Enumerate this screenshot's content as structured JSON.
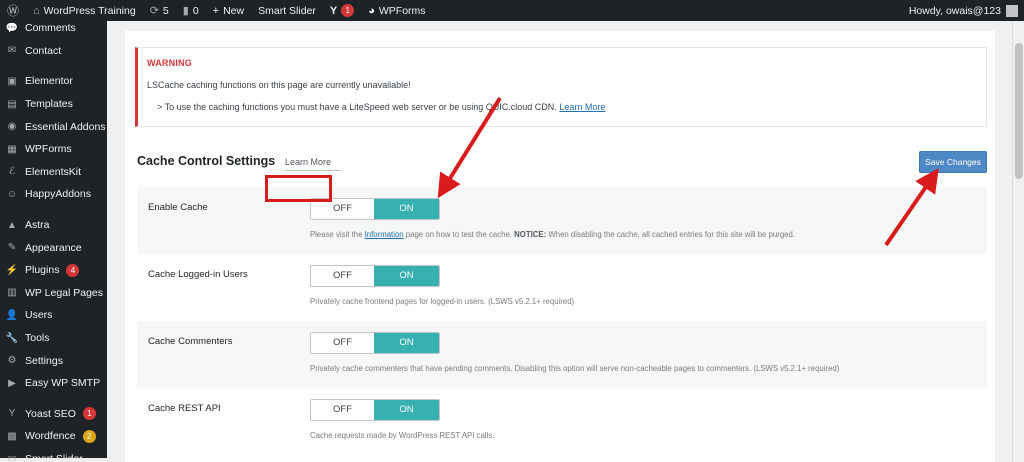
{
  "adminbar": {
    "site_name": "WordPress Training",
    "updates_count": "5",
    "comments_count": "0",
    "new_label": "New",
    "smart_slider_label": "Smart Slider",
    "yoast_badge": "1",
    "wpforms_label": "WPForms",
    "howdy_text": "Howdy, owais@123"
  },
  "sidebar": {
    "items": [
      {
        "label": "Comments",
        "icon": "comments-icon",
        "glyph": "💬"
      },
      {
        "label": "Contact",
        "icon": "mail-icon",
        "glyph": "✉"
      },
      {
        "label": "Elementor",
        "icon": "elementor-icon",
        "glyph": "▣"
      },
      {
        "label": "Templates",
        "icon": "folder-icon",
        "glyph": "▤"
      },
      {
        "label": "Essential Addons",
        "icon": "ea-icon",
        "glyph": "◉"
      },
      {
        "label": "WPForms",
        "icon": "wpforms-icon",
        "glyph": "▦"
      },
      {
        "label": "ElementsKit",
        "icon": "elementskit-icon",
        "glyph": "ℰ"
      },
      {
        "label": "HappyAddons",
        "icon": "happyaddons-icon",
        "glyph": "☺"
      },
      {
        "label": "Astra",
        "icon": "astra-icon",
        "glyph": "▲"
      },
      {
        "label": "Appearance",
        "icon": "brush-icon",
        "glyph": "✎"
      },
      {
        "label": "Plugins",
        "icon": "plugin-icon",
        "glyph": "⚡",
        "badge": "4"
      },
      {
        "label": "WP Legal Pages",
        "icon": "legal-icon",
        "glyph": "▥"
      },
      {
        "label": "Users",
        "icon": "users-icon",
        "glyph": "👤"
      },
      {
        "label": "Tools",
        "icon": "wrench-icon",
        "glyph": "🔧"
      },
      {
        "label": "Settings",
        "icon": "settings-icon",
        "glyph": "⚙"
      },
      {
        "label": "Easy WP SMTP",
        "icon": "smtp-icon",
        "glyph": "▶"
      },
      {
        "label": "Yoast SEO",
        "icon": "yoast-icon",
        "glyph": "Y",
        "badge": "1"
      },
      {
        "label": "Wordfence",
        "icon": "wordfence-icon",
        "glyph": "▩",
        "badge": "2",
        "badge_color": "#dba617"
      },
      {
        "label": "Smart Slider",
        "icon": "slider-icon",
        "glyph": "▭"
      }
    ]
  },
  "warning": {
    "title": "WARNING",
    "text": "LSCache caching functions on this page are currently unavailable!",
    "sub_text": "> To use the caching functions you must have a LiteSpeed web server or be using QUIC.cloud CDN.",
    "link": "Learn More"
  },
  "section": {
    "title": "Cache Control Settings",
    "learn_more": "Learn More",
    "save_label": "Save Changes"
  },
  "toggle": {
    "off_label": "OFF",
    "on_label": "ON"
  },
  "settings": [
    {
      "label": "Enable Cache",
      "desc_pre": "Please visit the ",
      "desc_link": "Information",
      "desc_mid": " page on how to test the cache. ",
      "desc_notice": "NOTICE:",
      "desc_post": " When disabling the cache, all cached entries for this site will be purged."
    },
    {
      "label": "Cache Logged-in Users",
      "desc": "Privately cache frontend pages for logged-in users. (LSWS v5.2.1+ required)"
    },
    {
      "label": "Cache Commenters",
      "desc": "Privately cache commenters that have pending comments. Disabling this option will serve non-cacheable pages to commenters. (LSWS v5.2.1+ required)"
    },
    {
      "label": "Cache REST API",
      "desc": "Cache requests made by WordPress REST API calls."
    }
  ],
  "colors": {
    "toggle_on": "#36b0b0",
    "annotation_red": "#d81b1b",
    "save_button": "#4f89c5",
    "warning_red": "#d63638"
  }
}
